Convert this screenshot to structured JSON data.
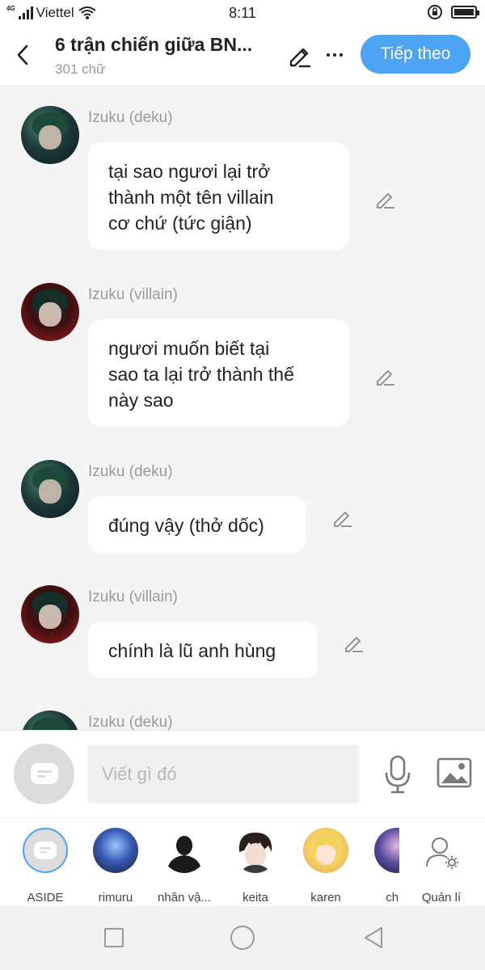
{
  "status_bar": {
    "carrier": "Viettel",
    "network": "4G",
    "time": "8:11"
  },
  "header": {
    "title": "6 trận chiến giữa BN...",
    "subtitle": "301 chữ",
    "next_button": "Tiếp theo"
  },
  "messages": [
    {
      "sender": "Izuku (deku)",
      "avatar": "deku",
      "text": "tại sao ngươi lại trở\nthành một tên villain\ncơ chứ (tức giận)"
    },
    {
      "sender": "Izuku (villain)",
      "avatar": "villain",
      "text": "ngươi muốn biết tại\nsao ta lại trở thành thế\nnày sao"
    },
    {
      "sender": "Izuku (deku)",
      "avatar": "deku",
      "text": "đúng vậy (thở dốc)"
    },
    {
      "sender": "Izuku (villain)",
      "avatar": "villain",
      "text": "chính là lũ anh hùng"
    },
    {
      "sender": "Izuku (deku)",
      "avatar": "deku",
      "text": ""
    }
  ],
  "composer": {
    "placeholder": "Viết gì đó"
  },
  "characters": [
    {
      "name": "ASIDE"
    },
    {
      "name": "rimuru"
    },
    {
      "name": "nhân vậ..."
    },
    {
      "name": "keita"
    },
    {
      "name": "karen"
    },
    {
      "name": "chia"
    }
  ],
  "manage_label": "Quản lí",
  "colors": {
    "accent": "#4da3f4",
    "background": "#f4f4f4",
    "bubble": "#ffffff"
  }
}
